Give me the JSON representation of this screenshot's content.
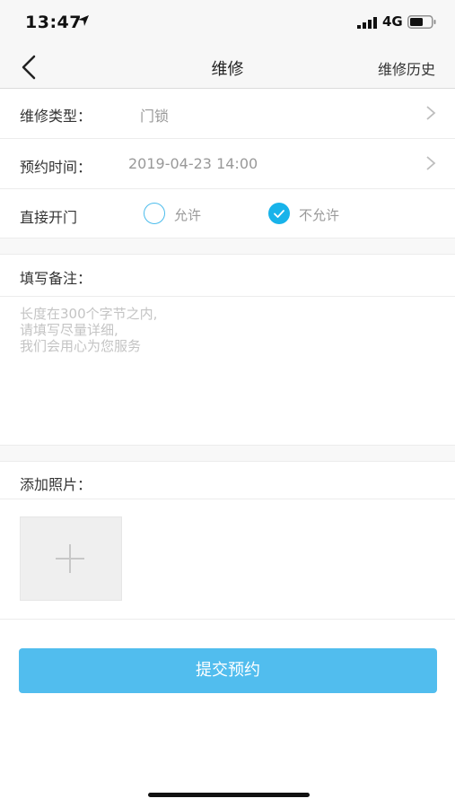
{
  "status_bar": {
    "time": "13:47",
    "network": "4G",
    "icons": [
      "location-arrow-icon",
      "signal-icon",
      "battery-icon"
    ]
  },
  "nav": {
    "back_icon": "chevron-left-icon",
    "title": "维修",
    "history_label": "维修历史"
  },
  "form": {
    "repair_type": {
      "label": "维修类型：",
      "value": "门锁"
    },
    "appointment_time": {
      "label": "预约时间：",
      "value": "2019-04-23 14:00"
    },
    "direct_open": {
      "label": "直接开门",
      "options": [
        {
          "label": "允许",
          "selected": false
        },
        {
          "label": "不允许",
          "selected": true
        }
      ]
    },
    "remarks": {
      "label": "填写备注：",
      "placeholder": "长度在300个字节之内,\n请填写尽量详细,\n我们会用心为您服务"
    },
    "photos": {
      "label": "添加照片：",
      "add_icon": "plus-icon"
    }
  },
  "submit_label": "提交预约",
  "colors": {
    "accent": "#18b3ea",
    "submit_bg": "#51bdee",
    "bar_bg": "#f7f7f7"
  }
}
